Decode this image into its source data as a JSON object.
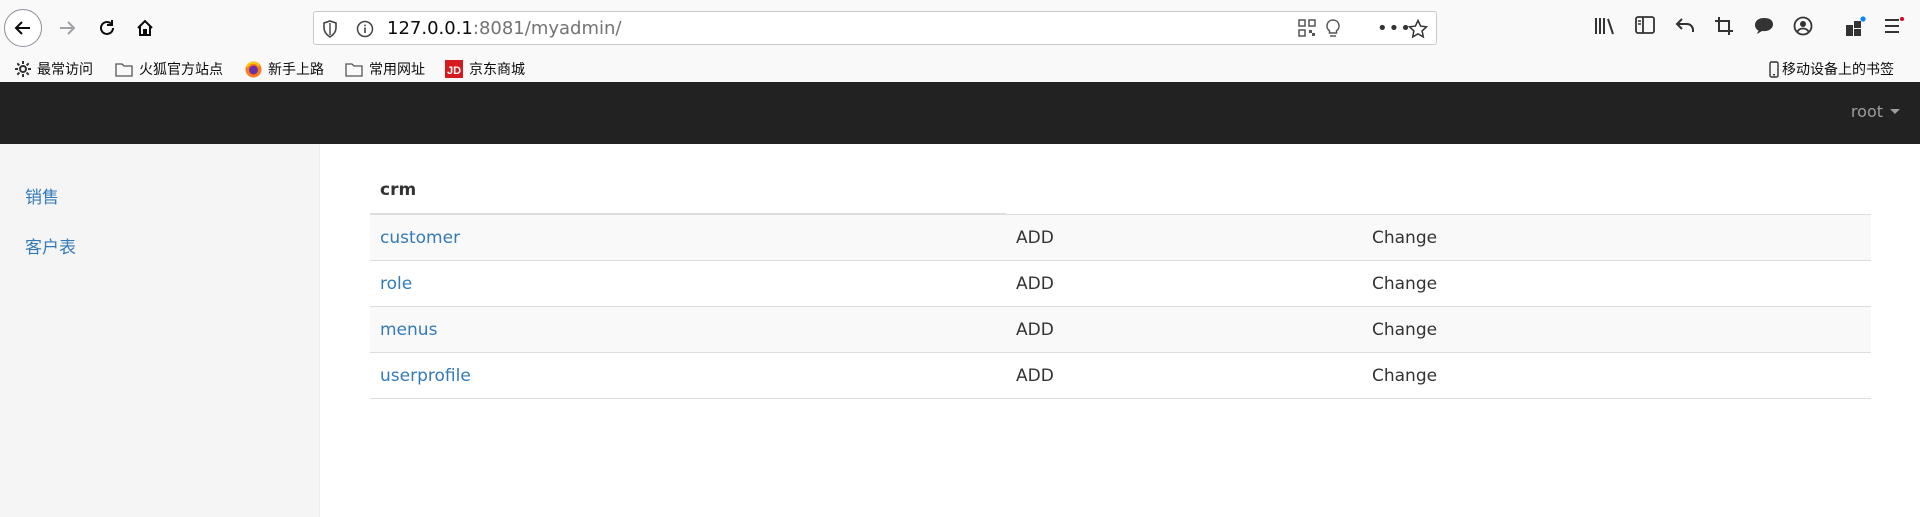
{
  "browser": {
    "url_host": "127.0.0.1",
    "url_rest": ":8081/myadmin/",
    "bookmarks": [
      {
        "label": "最常访问",
        "icon": "gear-icon"
      },
      {
        "label": "火狐官方站点",
        "icon": "folder-icon"
      },
      {
        "label": "新手上路",
        "icon": "firefox-icon"
      },
      {
        "label": "常用网址",
        "icon": "folder-icon"
      },
      {
        "label": "京东商城",
        "icon": "jd-icon"
      }
    ],
    "mobile_bookmarks": "移动设备上的书签"
  },
  "navbar": {
    "user": "root"
  },
  "sidebar": {
    "items": [
      {
        "label": "销售"
      },
      {
        "label": "客户表"
      }
    ]
  },
  "main": {
    "app_title": "crm",
    "models": [
      {
        "name": "customer",
        "add": "ADD",
        "change": "Change"
      },
      {
        "name": "role",
        "add": "ADD",
        "change": "Change"
      },
      {
        "name": "menus",
        "add": "ADD",
        "change": "Change"
      },
      {
        "name": "userprofile",
        "add": "ADD",
        "change": "Change"
      }
    ]
  },
  "colors": {
    "navbar_bg": "#222222",
    "link": "#337ab7",
    "sidebar_bg": "#f5f5f5"
  }
}
